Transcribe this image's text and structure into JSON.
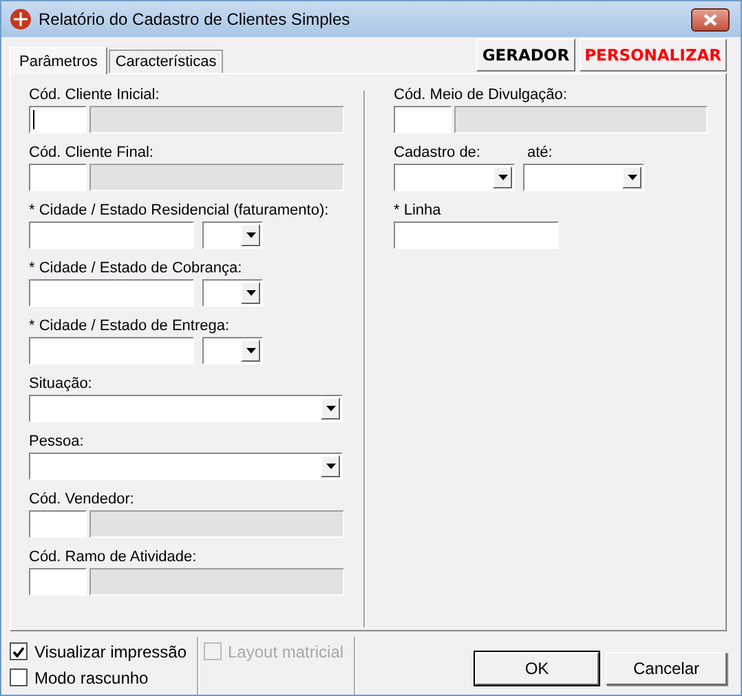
{
  "window": {
    "title": "Relatório do Cadastro de Clientes Simples"
  },
  "tabs": [
    {
      "label": "Parâmetros",
      "selected": true
    },
    {
      "label": "Características",
      "selected": false
    }
  ],
  "header_buttons": [
    {
      "label": "GERADOR",
      "kind": "plain"
    },
    {
      "label": "PERSONALIZAR",
      "kind": "alert"
    }
  ],
  "left_fields": [
    {
      "label": "Cód. Cliente Inicial:",
      "kind": "code",
      "focused": true
    },
    {
      "label": "Cód. Cliente Final:",
      "kind": "code",
      "focused": false
    },
    {
      "label": "* Cidade / Estado Residencial (faturamento):",
      "kind": "city"
    },
    {
      "label": "* Cidade / Estado de Cobrança:",
      "kind": "city"
    },
    {
      "label": "* Cidade / Estado de Entrega:",
      "kind": "city"
    },
    {
      "label": "Situação:",
      "kind": "select"
    },
    {
      "label": "Pessoa:",
      "kind": "select"
    },
    {
      "label": "Cód. Vendedor:",
      "kind": "code",
      "focused": false
    },
    {
      "label": "Cód. Ramo de Atividade:",
      "kind": "code",
      "focused": false
    }
  ],
  "right_fields": [
    {
      "label": "Cód. Meio de Divulgação:",
      "kind": "code",
      "focused": false
    },
    {
      "label": "Cadastro de:",
      "label_2": "até:",
      "kind": "range"
    },
    {
      "label": "* Linha",
      "kind": "text"
    }
  ],
  "option_groups": [
    [
      {
        "label": "Visualizar impressão",
        "checked": true,
        "disabled": false
      },
      {
        "label": "Modo rascunho",
        "checked": false,
        "disabled": false
      }
    ],
    [
      {
        "label": "Layout matricial",
        "checked": false,
        "disabled": true
      }
    ]
  ],
  "buttons": [
    "OK",
    "Cancelar"
  ]
}
